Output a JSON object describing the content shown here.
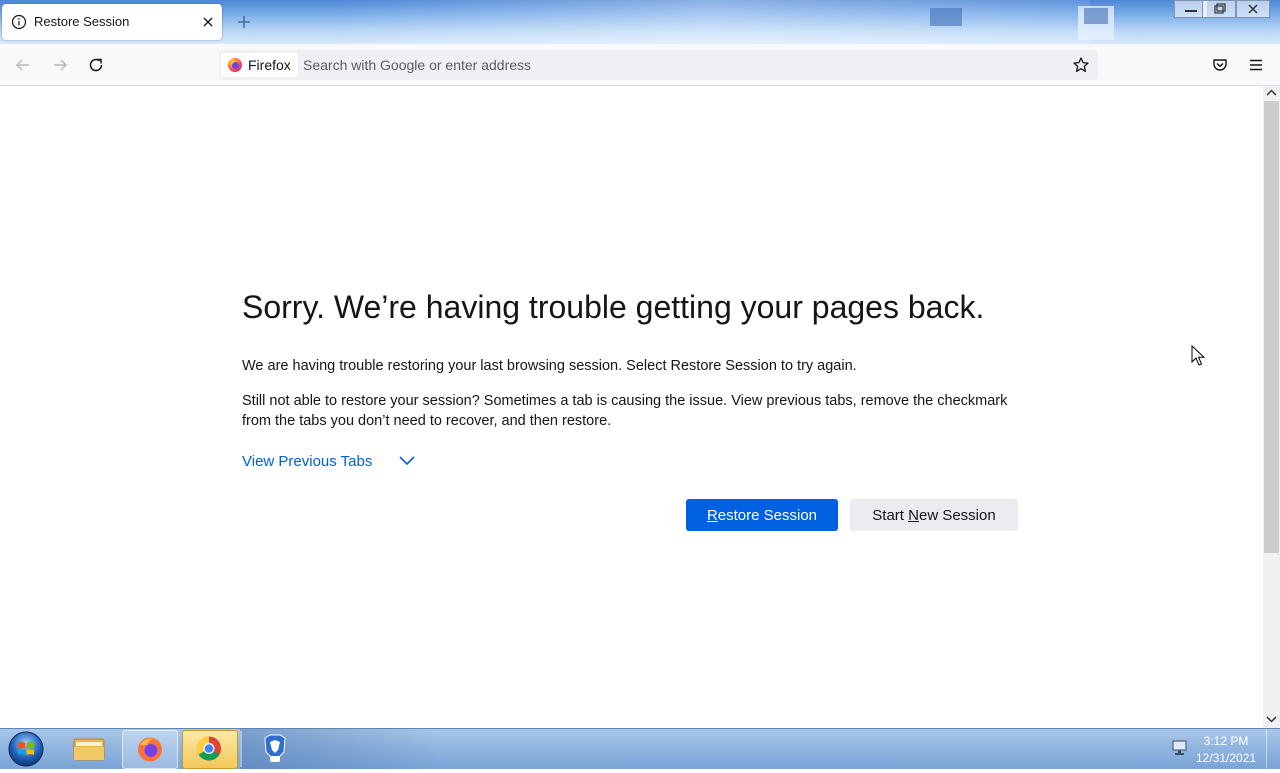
{
  "window": {
    "tab_title": "Restore Session",
    "identity_label": "Firefox",
    "url_placeholder": "Search with Google or enter address"
  },
  "content": {
    "title": "Sorry. We’re having trouble getting your pages back.",
    "paragraph1": "We are having trouble restoring your last browsing session. Select Restore Session to try again.",
    "paragraph2": "Still not able to restore your session? Sometimes a tab is causing the issue. View previous tabs, remove the checkmark from the tabs you don’t need to recover, and then restore.",
    "view_previous_label": "View Previous Tabs",
    "restore_button": {
      "accesskey": "R",
      "rest": "estore Session"
    },
    "new_session_button": {
      "before": "Start ",
      "accesskey": "N",
      "rest": "ew Session"
    }
  },
  "taskbar": {
    "time": "3:12 PM",
    "date": "12/31/2021"
  },
  "colors": {
    "accent": "#0061e0",
    "secondary_button": "#ececf0",
    "text": "#15141a"
  }
}
